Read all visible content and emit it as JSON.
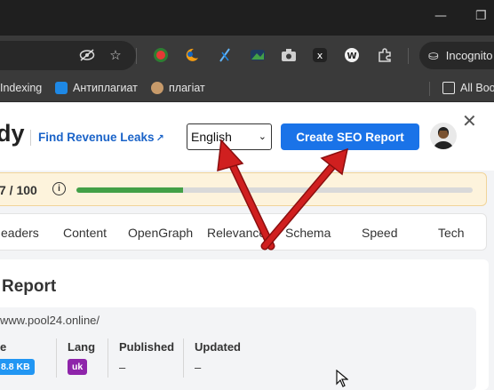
{
  "browser": {
    "incognito_label": "Incognito",
    "bookmarks": [
      {
        "label": "Indexing"
      },
      {
        "label": "Антиплагиат"
      },
      {
        "label": "плагіат"
      }
    ],
    "all_bookmarks_label": "All Boo"
  },
  "header": {
    "brand": "dy",
    "revenue_link": "Find Revenue Leaks",
    "language_selected": "English",
    "cta_label": "Create SEO Report",
    "close_symbol": "✕"
  },
  "score": {
    "text": "7 / 100",
    "info_symbol": "i",
    "progress_fraction": 0.27
  },
  "tabs": [
    {
      "label": "eaders"
    },
    {
      "label": "Content"
    },
    {
      "label": "OpenGraph"
    },
    {
      "label": "Relevance"
    },
    {
      "label": "Schema"
    },
    {
      "label": "Speed"
    },
    {
      "label": "Tech"
    }
  ],
  "report": {
    "title": "Report",
    "url": "www.pool24.online/",
    "columns": [
      {
        "label": "e",
        "badge": "8.8 KB",
        "badge_color": "#2196f3"
      },
      {
        "label": "Lang",
        "badge": "uk",
        "badge_color": "#8e24aa"
      },
      {
        "label": "Published",
        "value": "–"
      },
      {
        "label": "Updated",
        "value": "–"
      }
    ]
  },
  "colors": {
    "accent": "#1a73e8",
    "progress": "#43a047",
    "arrow": "#d01f1f",
    "score_bg": "#fdf3dc"
  }
}
